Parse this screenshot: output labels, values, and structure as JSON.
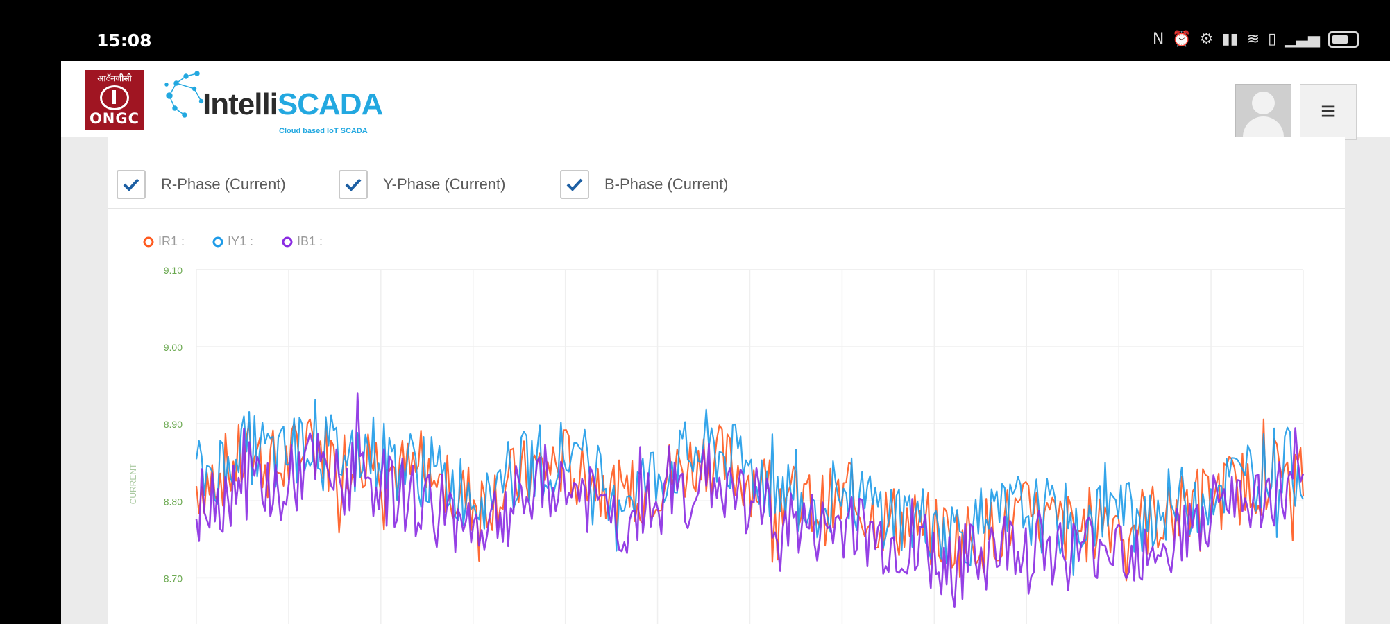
{
  "status_bar": {
    "time": "15:08",
    "icons": [
      "nfc-icon",
      "alarm-icon",
      "settings-icon",
      "signal-icon",
      "wifi-icon",
      "sim-icon",
      "signal-strength-icon",
      "battery-icon"
    ]
  },
  "header": {
    "logo_ongc": {
      "top_text": "आॅनजीसी",
      "bottom_text": "ONGC"
    },
    "logo_intelli": {
      "name_dark": "Intelli",
      "name_accent": "SCADA",
      "tagline": "Cloud based IoT SCADA"
    },
    "menu_icon": "hamburger-icon"
  },
  "filters": [
    {
      "label": "R-Phase (Current)",
      "checked": true
    },
    {
      "label": "Y-Phase (Current)",
      "checked": true
    },
    {
      "label": "B-Phase (Current)",
      "checked": true
    }
  ],
  "colors": {
    "accent": "#23a8e0",
    "check": "#1d5fa3",
    "r_phase": "#ff5a1f",
    "y_phase": "#1e9be8",
    "b_phase": "#8a2be2"
  },
  "chart_data": {
    "type": "line",
    "legend": [
      "IR1 :",
      "IY1 :",
      "IB1 :"
    ],
    "ylabel": "CURRENT",
    "yticks": [
      "9.10",
      "9.00",
      "8.90",
      "8.80",
      "8.70"
    ],
    "ylim": [
      8.64,
      9.1
    ],
    "grid": true,
    "legend_position": "top-left",
    "series": [
      {
        "name": "IR1 :",
        "color": "#ff5a1f",
        "values": [
          8.82,
          8.84,
          8.86,
          8.84,
          8.88,
          8.85,
          8.86,
          8.84,
          8.83,
          8.81,
          8.8,
          8.82,
          8.84,
          8.85,
          8.83,
          8.8,
          8.82,
          8.84,
          8.86,
          8.84,
          8.82,
          8.8,
          8.79,
          8.8,
          8.78,
          8.77,
          8.76,
          8.75,
          8.76,
          8.78,
          8.77,
          8.76,
          8.78,
          8.77,
          8.78,
          8.79,
          8.81,
          8.82,
          8.84,
          8.83
        ]
      },
      {
        "name": "IY1 :",
        "color": "#1e9be8",
        "values": [
          8.83,
          8.85,
          8.87,
          8.85,
          8.89,
          8.86,
          8.87,
          8.85,
          8.84,
          8.82,
          8.81,
          8.83,
          8.85,
          8.86,
          8.84,
          8.81,
          8.83,
          8.85,
          8.87,
          8.85,
          8.83,
          8.81,
          8.8,
          8.81,
          8.79,
          8.78,
          8.77,
          8.76,
          8.77,
          8.79,
          8.78,
          8.77,
          8.79,
          8.78,
          8.79,
          8.8,
          8.82,
          8.83,
          8.85,
          8.84
        ]
      },
      {
        "name": "IB1 :",
        "color": "#8a2be2",
        "values": [
          8.79,
          8.81,
          8.83,
          8.81,
          8.85,
          8.82,
          8.83,
          8.81,
          8.8,
          8.78,
          8.77,
          8.79,
          8.81,
          8.82,
          8.8,
          8.77,
          8.79,
          8.81,
          8.83,
          8.81,
          8.79,
          8.77,
          8.76,
          8.77,
          8.75,
          8.74,
          8.73,
          8.72,
          8.73,
          8.75,
          8.74,
          8.73,
          8.75,
          8.74,
          8.75,
          8.76,
          8.78,
          8.79,
          8.81,
          8.8
        ]
      }
    ]
  }
}
